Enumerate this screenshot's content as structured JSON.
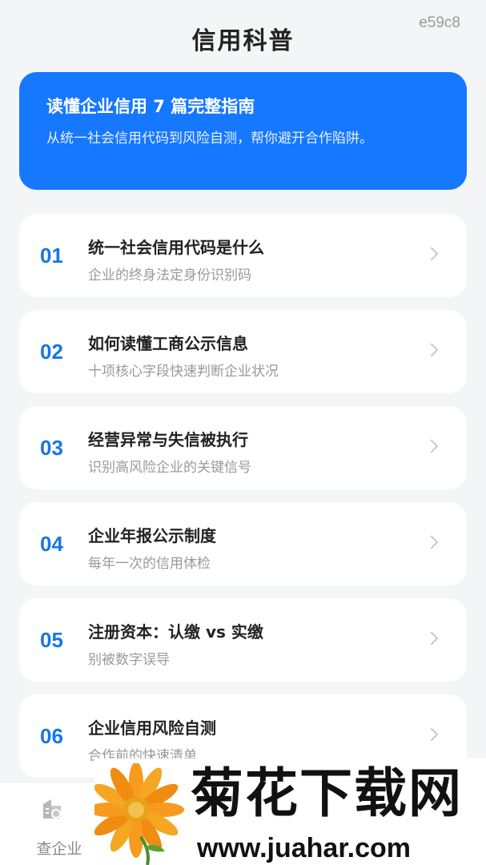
{
  "header": {
    "title": "信用科普",
    "corner_code": "e59c8"
  },
  "hero": {
    "title": "读懂企业信用 7 篇完整指南",
    "description": "从统一社会信用代码到风险自测，帮你避开合作陷阱。"
  },
  "articles": [
    {
      "num": "01",
      "title": "统一社会信用代码是什么",
      "subtitle": "企业的终身法定身份识别码"
    },
    {
      "num": "02",
      "title": "如何读懂工商公示信息",
      "subtitle": "十项核心字段快速判断企业状况"
    },
    {
      "num": "03",
      "title": "经营异常与失信被执行",
      "subtitle": "识别高风险企业的关键信号"
    },
    {
      "num": "04",
      "title": "企业年报公示制度",
      "subtitle": "每年一次的信用体检"
    },
    {
      "num": "05",
      "title": "注册资本：认缴 vs 实缴",
      "subtitle": "别被数字误导"
    },
    {
      "num": "06",
      "title": "企业信用风险自测",
      "subtitle": "合作前的快速清单"
    }
  ],
  "tabbar": {
    "tabs": [
      {
        "label": "查企业",
        "icon": "company-search-icon"
      }
    ]
  },
  "watermark": {
    "title": "菊花下载网",
    "url": "www.juahar.com"
  },
  "colors": {
    "accent": "#1677ff",
    "number": "#1677e6",
    "background": "#f4f5f7"
  }
}
